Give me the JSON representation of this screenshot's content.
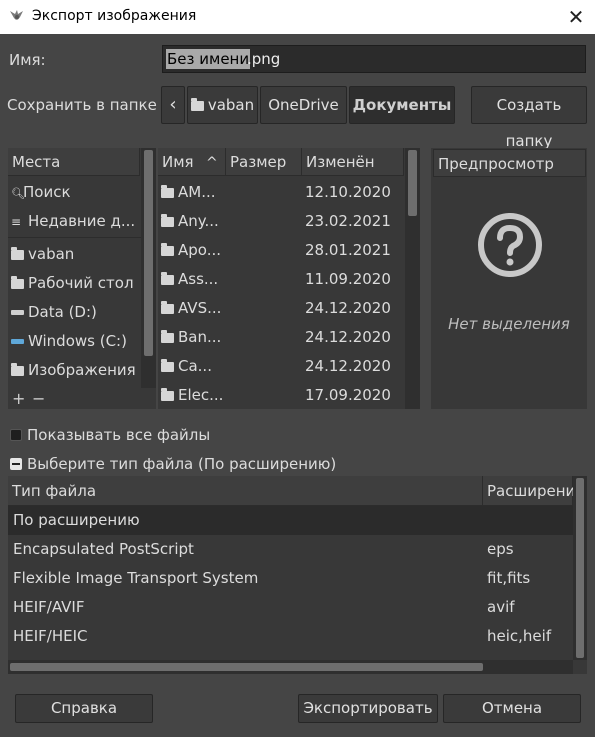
{
  "window": {
    "title": "Экспорт изображения"
  },
  "name_row": {
    "label": "Имя:",
    "selected": "Без имени",
    "extension": ".png"
  },
  "folder_row": {
    "label": "Сохранить в папке",
    "back_glyph": "‹",
    "crumbs": [
      "vaban",
      "OneDrive",
      "Документы"
    ],
    "create_folder": "Создать папку"
  },
  "places": {
    "header": "Места",
    "items": [
      {
        "icon": "search-icon",
        "label": "Поиск"
      },
      {
        "icon": "recent-icon",
        "label": "Недавние д..."
      },
      {
        "icon": "folder-icon",
        "label": "vaban"
      },
      {
        "icon": "folder-icon",
        "label": "Рабочий стол"
      },
      {
        "icon": "drive-icon",
        "label": "Data (D:)"
      },
      {
        "icon": "system-drive-icon",
        "label": "Windows (C:)"
      },
      {
        "icon": "folder-icon",
        "label": "Изображения"
      }
    ],
    "add": "+",
    "remove": "−"
  },
  "files": {
    "columns": {
      "name": "Имя",
      "size": "Размер",
      "modified": "Изменён"
    },
    "sort_glyph": "^",
    "rows": [
      {
        "name": "AM...",
        "modified": "12.10.2020"
      },
      {
        "name": "Any...",
        "modified": "23.02.2021"
      },
      {
        "name": "Apo...",
        "modified": "28.01.2021"
      },
      {
        "name": "Ass...",
        "modified": "11.09.2020"
      },
      {
        "name": "AVS...",
        "modified": "24.12.2020"
      },
      {
        "name": "Ban...",
        "modified": "24.12.2020"
      },
      {
        "name": "Ca...",
        "modified": "24.12.2020"
      },
      {
        "name": "Elec...",
        "modified": "17.09.2020"
      }
    ]
  },
  "preview": {
    "header": "Предпросмотр",
    "empty": "Нет выделения"
  },
  "show_all": {
    "label": "Показывать все файлы",
    "checked": false
  },
  "filetype_expander": {
    "label": "Выберите тип файла (По расширению)"
  },
  "filetypes": {
    "columns": {
      "type": "Тип файла",
      "ext": "Расширени"
    },
    "rows": [
      {
        "type": "По расширению",
        "ext": ""
      },
      {
        "type": "Encapsulated PostScript",
        "ext": "eps"
      },
      {
        "type": "Flexible Image Transport System",
        "ext": "fit,fits"
      },
      {
        "type": "HEIF/AVIF",
        "ext": "avif"
      },
      {
        "type": "HEIF/HEIC",
        "ext": "heic,heif"
      }
    ]
  },
  "buttons": {
    "help": "Справка",
    "export": "Экспортировать",
    "cancel": "Отмена"
  },
  "colors": {
    "background": "#454545",
    "selected_row": "#2b2b2b",
    "list_bg": "#383838"
  }
}
